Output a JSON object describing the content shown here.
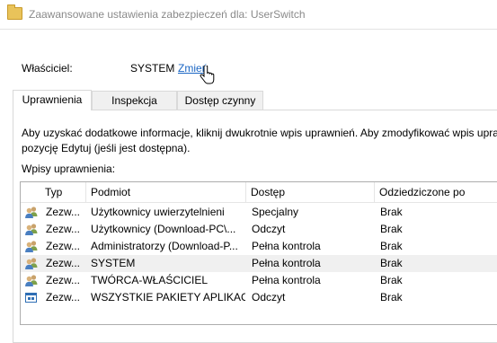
{
  "window": {
    "title": "Zaawansowane ustawienia zabezpieczeń dla: UserSwitch"
  },
  "owner": {
    "label": "Właściciel:",
    "value": "SYSTEM",
    "change_link": "Zmień"
  },
  "tabs": [
    {
      "label": "Uprawnienia",
      "active": true
    },
    {
      "label": "Inspekcja",
      "active": false
    },
    {
      "label": "Dostęp czynny",
      "active": false
    }
  ],
  "info_text_line1": "Aby uzyskać dodatkowe informacje, kliknij dwukrotnie wpis uprawnień. Aby zmodyfikować wpis upra",
  "info_text_line2": "pozycję Edytuj (jeśli jest dostępna).",
  "entries_label": "Wpisy uprawnienia:",
  "columns": [
    "Typ",
    "Podmiot",
    "Dostęp",
    "Odziedziczone po"
  ],
  "rows": [
    {
      "type": "Zezw...",
      "principal": "Użytkownicy uwierzytelnieni",
      "access": "Specjalny",
      "inherited": "Brak",
      "icon": "users-icon",
      "selected": false
    },
    {
      "type": "Zezw...",
      "principal": "Użytkownicy (Download-PC\\...",
      "access": "Odczyt",
      "inherited": "Brak",
      "icon": "users-icon",
      "selected": false
    },
    {
      "type": "Zezw...",
      "principal": "Administratorzy (Download-P...",
      "access": "Pełna kontrola",
      "inherited": "Brak",
      "icon": "users-icon",
      "selected": false
    },
    {
      "type": "Zezw...",
      "principal": "SYSTEM",
      "access": "Pełna kontrola",
      "inherited": "Brak",
      "icon": "users-icon",
      "selected": true
    },
    {
      "type": "Zezw...",
      "principal": "TWÓRCA-WŁAŚCICIEL",
      "access": "Pełna kontrola",
      "inherited": "Brak",
      "icon": "users-icon",
      "selected": false
    },
    {
      "type": "Zezw...",
      "principal": "WSZYSTKIE PAKIETY APLIKACJI",
      "access": "Odczyt",
      "inherited": "Brak",
      "icon": "app-packages-icon",
      "selected": false
    }
  ],
  "colors": {
    "link": "#1a66c4",
    "selected_row": "#f0f0f0",
    "title_text": "#8a8a8a"
  }
}
